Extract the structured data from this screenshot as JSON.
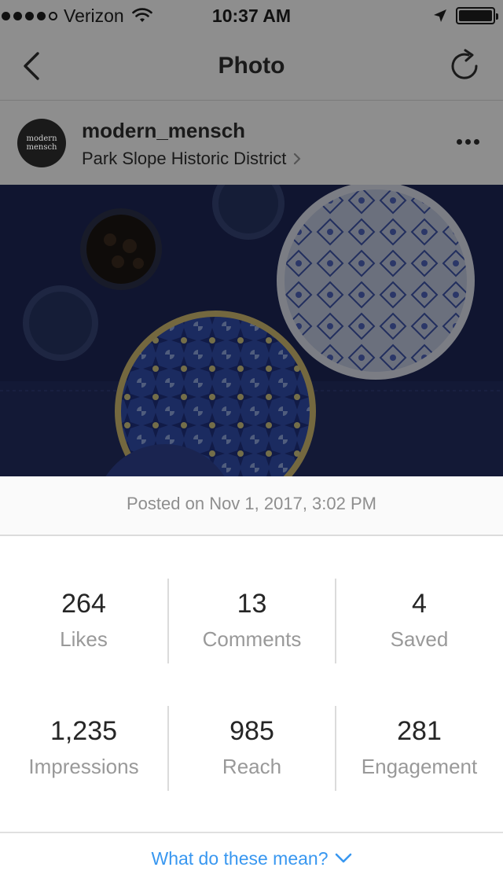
{
  "status_bar": {
    "carrier": "Verizon",
    "time": "10:37 AM",
    "signal_bars": 4,
    "icons": [
      "wifi-icon",
      "location-arrow-icon",
      "battery-icon"
    ]
  },
  "nav": {
    "title": "Photo",
    "back_icon": "chevron-left-icon",
    "refresh_icon": "refresh-icon"
  },
  "post": {
    "avatar_text_line1": "modern",
    "avatar_text_line2": "mensch",
    "username": "modern_mensch",
    "location": "Park Slope Historic District",
    "more_icon": "more-horizontal-icon"
  },
  "posted_on": "Posted on Nov 1, 2017, 3:02 PM",
  "stats": [
    {
      "value": "264",
      "label": "Likes"
    },
    {
      "value": "13",
      "label": "Comments"
    },
    {
      "value": "4",
      "label": "Saved"
    },
    {
      "value": "1,235",
      "label": "Impressions"
    },
    {
      "value": "985",
      "label": "Reach"
    },
    {
      "value": "281",
      "label": "Engagement"
    }
  ],
  "help_link": "What do these mean?",
  "colors": {
    "link": "#3897f0",
    "muted_text": "#8e8e8e",
    "dim_overlay": "#8e8e8e"
  }
}
